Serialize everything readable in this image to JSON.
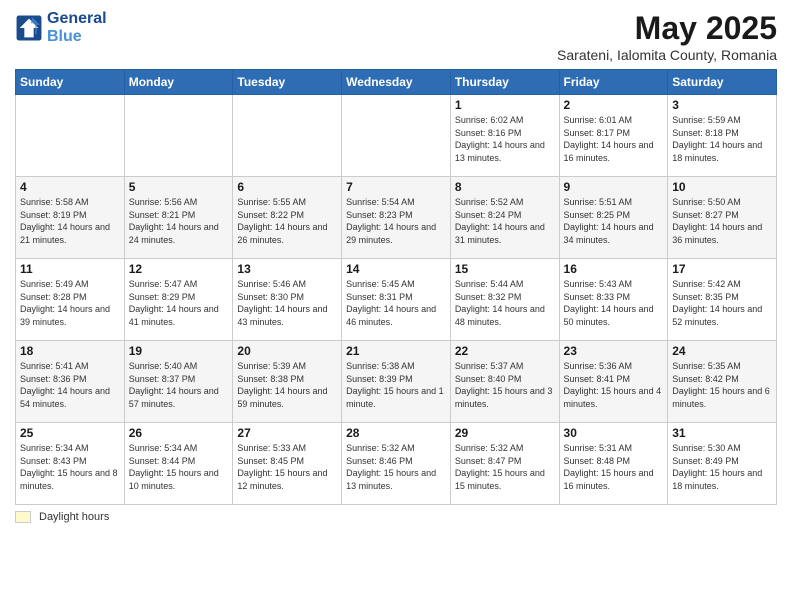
{
  "header": {
    "logo_line1": "General",
    "logo_line2": "Blue",
    "title": "May 2025",
    "subtitle": "Sarateni, Ialomita County, Romania"
  },
  "days_of_week": [
    "Sunday",
    "Monday",
    "Tuesday",
    "Wednesday",
    "Thursday",
    "Friday",
    "Saturday"
  ],
  "weeks": [
    [
      {
        "day": "",
        "info": ""
      },
      {
        "day": "",
        "info": ""
      },
      {
        "day": "",
        "info": ""
      },
      {
        "day": "",
        "info": ""
      },
      {
        "day": "1",
        "info": "Sunrise: 6:02 AM\nSunset: 8:16 PM\nDaylight: 14 hours\nand 13 minutes."
      },
      {
        "day": "2",
        "info": "Sunrise: 6:01 AM\nSunset: 8:17 PM\nDaylight: 14 hours\nand 16 minutes."
      },
      {
        "day": "3",
        "info": "Sunrise: 5:59 AM\nSunset: 8:18 PM\nDaylight: 14 hours\nand 18 minutes."
      }
    ],
    [
      {
        "day": "4",
        "info": "Sunrise: 5:58 AM\nSunset: 8:19 PM\nDaylight: 14 hours\nand 21 minutes."
      },
      {
        "day": "5",
        "info": "Sunrise: 5:56 AM\nSunset: 8:21 PM\nDaylight: 14 hours\nand 24 minutes."
      },
      {
        "day": "6",
        "info": "Sunrise: 5:55 AM\nSunset: 8:22 PM\nDaylight: 14 hours\nand 26 minutes."
      },
      {
        "day": "7",
        "info": "Sunrise: 5:54 AM\nSunset: 8:23 PM\nDaylight: 14 hours\nand 29 minutes."
      },
      {
        "day": "8",
        "info": "Sunrise: 5:52 AM\nSunset: 8:24 PM\nDaylight: 14 hours\nand 31 minutes."
      },
      {
        "day": "9",
        "info": "Sunrise: 5:51 AM\nSunset: 8:25 PM\nDaylight: 14 hours\nand 34 minutes."
      },
      {
        "day": "10",
        "info": "Sunrise: 5:50 AM\nSunset: 8:27 PM\nDaylight: 14 hours\nand 36 minutes."
      }
    ],
    [
      {
        "day": "11",
        "info": "Sunrise: 5:49 AM\nSunset: 8:28 PM\nDaylight: 14 hours\nand 39 minutes."
      },
      {
        "day": "12",
        "info": "Sunrise: 5:47 AM\nSunset: 8:29 PM\nDaylight: 14 hours\nand 41 minutes."
      },
      {
        "day": "13",
        "info": "Sunrise: 5:46 AM\nSunset: 8:30 PM\nDaylight: 14 hours\nand 43 minutes."
      },
      {
        "day": "14",
        "info": "Sunrise: 5:45 AM\nSunset: 8:31 PM\nDaylight: 14 hours\nand 46 minutes."
      },
      {
        "day": "15",
        "info": "Sunrise: 5:44 AM\nSunset: 8:32 PM\nDaylight: 14 hours\nand 48 minutes."
      },
      {
        "day": "16",
        "info": "Sunrise: 5:43 AM\nSunset: 8:33 PM\nDaylight: 14 hours\nand 50 minutes."
      },
      {
        "day": "17",
        "info": "Sunrise: 5:42 AM\nSunset: 8:35 PM\nDaylight: 14 hours\nand 52 minutes."
      }
    ],
    [
      {
        "day": "18",
        "info": "Sunrise: 5:41 AM\nSunset: 8:36 PM\nDaylight: 14 hours\nand 54 minutes."
      },
      {
        "day": "19",
        "info": "Sunrise: 5:40 AM\nSunset: 8:37 PM\nDaylight: 14 hours\nand 57 minutes."
      },
      {
        "day": "20",
        "info": "Sunrise: 5:39 AM\nSunset: 8:38 PM\nDaylight: 14 hours\nand 59 minutes."
      },
      {
        "day": "21",
        "info": "Sunrise: 5:38 AM\nSunset: 8:39 PM\nDaylight: 15 hours\nand 1 minute."
      },
      {
        "day": "22",
        "info": "Sunrise: 5:37 AM\nSunset: 8:40 PM\nDaylight: 15 hours\nand 3 minutes."
      },
      {
        "day": "23",
        "info": "Sunrise: 5:36 AM\nSunset: 8:41 PM\nDaylight: 15 hours\nand 4 minutes."
      },
      {
        "day": "24",
        "info": "Sunrise: 5:35 AM\nSunset: 8:42 PM\nDaylight: 15 hours\nand 6 minutes."
      }
    ],
    [
      {
        "day": "25",
        "info": "Sunrise: 5:34 AM\nSunset: 8:43 PM\nDaylight: 15 hours\nand 8 minutes."
      },
      {
        "day": "26",
        "info": "Sunrise: 5:34 AM\nSunset: 8:44 PM\nDaylight: 15 hours\nand 10 minutes."
      },
      {
        "day": "27",
        "info": "Sunrise: 5:33 AM\nSunset: 8:45 PM\nDaylight: 15 hours\nand 12 minutes."
      },
      {
        "day": "28",
        "info": "Sunrise: 5:32 AM\nSunset: 8:46 PM\nDaylight: 15 hours\nand 13 minutes."
      },
      {
        "day": "29",
        "info": "Sunrise: 5:32 AM\nSunset: 8:47 PM\nDaylight: 15 hours\nand 15 minutes."
      },
      {
        "day": "30",
        "info": "Sunrise: 5:31 AM\nSunset: 8:48 PM\nDaylight: 15 hours\nand 16 minutes."
      },
      {
        "day": "31",
        "info": "Sunrise: 5:30 AM\nSunset: 8:49 PM\nDaylight: 15 hours\nand 18 minutes."
      }
    ]
  ],
  "footer": {
    "daylight_label": "Daylight hours"
  }
}
